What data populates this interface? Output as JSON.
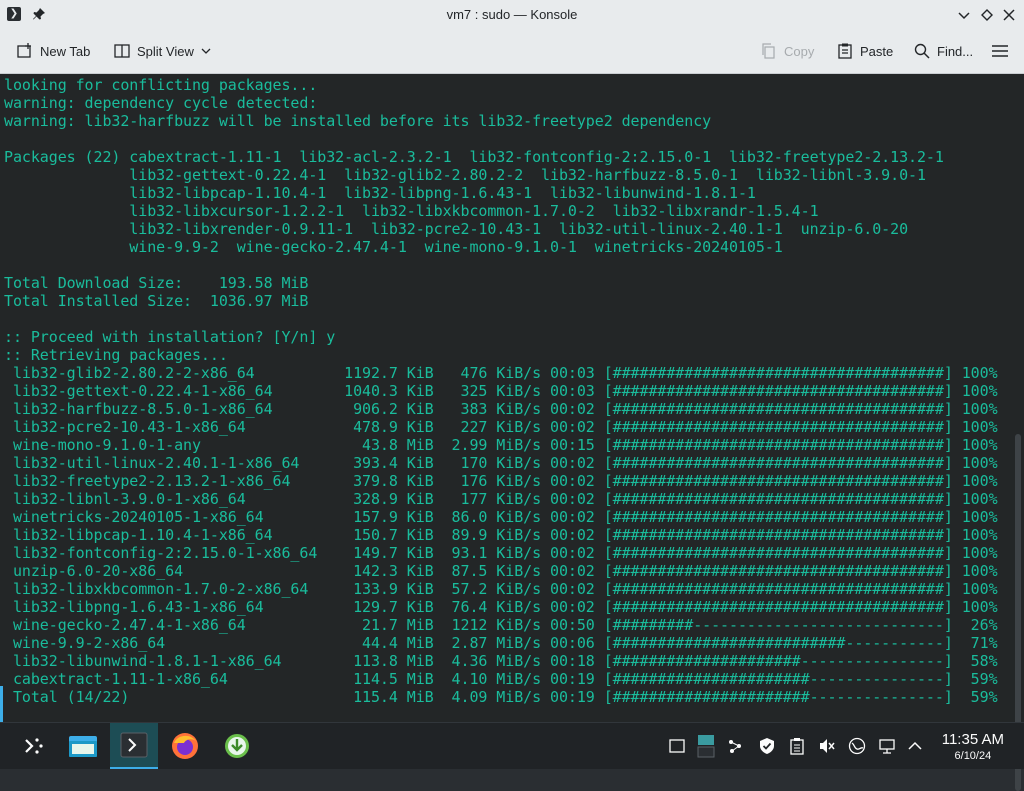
{
  "window": {
    "title": "vm7 : sudo — Konsole"
  },
  "toolbar": {
    "new_tab": "New Tab",
    "split_view": "Split View",
    "copy": "Copy",
    "paste": "Paste",
    "find": "Find..."
  },
  "terminal": {
    "lines": [
      "looking for conflicting packages...",
      "warning: dependency cycle detected:",
      "warning: lib32-harfbuzz will be installed before its lib32-freetype2 dependency",
      "",
      "Packages (22) cabextract-1.11-1  lib32-acl-2.3.2-1  lib32-fontconfig-2:2.15.0-1  lib32-freetype2-2.13.2-1",
      "              lib32-gettext-0.22.4-1  lib32-glib2-2.80.2-2  lib32-harfbuzz-8.5.0-1  lib32-libnl-3.9.0-1",
      "              lib32-libpcap-1.10.4-1  lib32-libpng-1.6.43-1  lib32-libunwind-1.8.1-1",
      "              lib32-libxcursor-1.2.2-1  lib32-libxkbcommon-1.7.0-2  lib32-libxrandr-1.5.4-1",
      "              lib32-libxrender-0.9.11-1  lib32-pcre2-10.43-1  lib32-util-linux-2.40.1-1  unzip-6.0-20",
      "              wine-9.9-2  wine-gecko-2.47.4-1  wine-mono-9.1.0-1  winetricks-20240105-1",
      "",
      "Total Download Size:    193.58 MiB",
      "Total Installed Size:  1036.97 MiB",
      "",
      ":: Proceed with installation? [Y/n] y",
      ":: Retrieving packages...",
      " lib32-glib2-2.80.2-2-x86_64          1192.7 KiB   476 KiB/s 00:03 [#####################################] 100%",
      " lib32-gettext-0.22.4-1-x86_64        1040.3 KiB   325 KiB/s 00:03 [#####################################] 100%",
      " lib32-harfbuzz-8.5.0-1-x86_64         906.2 KiB   383 KiB/s 00:02 [#####################################] 100%",
      " lib32-pcre2-10.43-1-x86_64            478.9 KiB   227 KiB/s 00:02 [#####################################] 100%",
      " wine-mono-9.1.0-1-any                  43.8 MiB  2.99 MiB/s 00:15 [#####################################] 100%",
      " lib32-util-linux-2.40.1-1-x86_64      393.4 KiB   170 KiB/s 00:02 [#####################################] 100%",
      " lib32-freetype2-2.13.2-1-x86_64       379.8 KiB   176 KiB/s 00:02 [#####################################] 100%",
      " lib32-libnl-3.9.0-1-x86_64            328.9 KiB   177 KiB/s 00:02 [#####################################] 100%",
      " winetricks-20240105-1-x86_64          157.9 KiB  86.0 KiB/s 00:02 [#####################################] 100%",
      " lib32-libpcap-1.10.4-1-x86_64         150.7 KiB  89.9 KiB/s 00:02 [#####################################] 100%",
      " lib32-fontconfig-2:2.15.0-1-x86_64    149.7 KiB  93.1 KiB/s 00:02 [#####################################] 100%",
      " unzip-6.0-20-x86_64                   142.3 KiB  87.5 KiB/s 00:02 [#####################################] 100%",
      " lib32-libxkbcommon-1.7.0-2-x86_64     133.9 KiB  57.2 KiB/s 00:02 [#####################################] 100%",
      " lib32-libpng-1.6.43-1-x86_64          129.7 KiB  76.4 KiB/s 00:02 [#####################################] 100%",
      " wine-gecko-2.47.4-1-x86_64             21.7 MiB  1212 KiB/s 00:50 [#########----------------------------]  26%",
      " wine-9.9-2-x86_64                      44.4 MiB  2.87 MiB/s 00:06 [##########################-----------]  71%",
      " lib32-libunwind-1.8.1-1-x86_64        113.8 MiB  4.36 MiB/s 00:18 [#####################----------------]  58%",
      " cabextract-1.11-1-x86_64              114.5 MiB  4.10 MiB/s 00:19 [######################---------------]  59%",
      " Total (14/22)                         115.4 MiB  4.09 MiB/s 00:19 [######################---------------]  59%"
    ]
  },
  "taskbar": {
    "clock_time": "11:35 AM",
    "clock_date": "6/10/24"
  },
  "colors": {
    "terminal_fg": "#1abc9c",
    "terminal_bg": "#232627",
    "accent": "#3daee9"
  }
}
